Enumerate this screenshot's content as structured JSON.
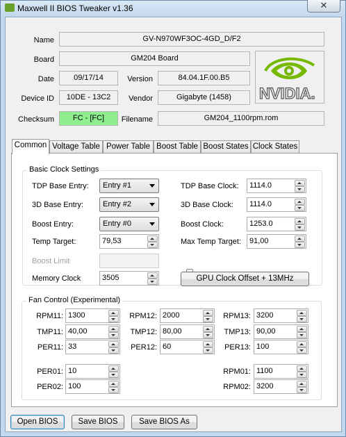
{
  "window": {
    "title": "Maxwell II BIOS Tweaker v1.36",
    "close": "✕"
  },
  "info": {
    "name_label": "Name",
    "name": "GV-N970WF3OC-4GD_D/F2",
    "board_label": "Board",
    "board": "GM204 Board",
    "date_label": "Date",
    "date": "09/17/14",
    "version_label": "Version",
    "version": "84.04.1F.00.B5",
    "device_label": "Device ID",
    "device": "10DE - 13C2",
    "vendor_label": "Vendor",
    "vendor": "Gigabyte (1458)",
    "checksum_label": "Checksum",
    "checksum": "FC - [FC]",
    "filename_label": "Filename",
    "filename": "GM204_1100rpm.rom",
    "logo_text": "NVIDIA."
  },
  "tabs": [
    "Common",
    "Voltage Table",
    "Power Table",
    "Boost Table",
    "Boost States",
    "Clock States"
  ],
  "clock": {
    "group_title": "Basic Clock Settings",
    "tdp_base_entry_label": "TDP Base Entry:",
    "tdp_base_entry": "Entry #1",
    "base3d_entry_label": "3D Base Entry:",
    "base3d_entry": "Entry #2",
    "boost_entry_label": "Boost Entry:",
    "boost_entry": "Entry #0",
    "temp_target_label": "Temp Target:",
    "temp_target": "79,53",
    "boost_limit_label": "Boost Limit",
    "memory_clock_label": "Memory Clock",
    "memory_clock": "3505",
    "tdp_base_clock_label": "TDP Base Clock:",
    "tdp_base_clock": "1114.0",
    "base3d_clock_label": "3D Base Clock:",
    "base3d_clock": "1114.0",
    "boost_clock_label": "Boost Clock:",
    "boost_clock": "1253.0",
    "max_temp_label": "Max Temp Target:",
    "max_temp": "91,00",
    "gpu_offset_button": "GPU Clock Offset + 13MHz"
  },
  "fan": {
    "group_title": "Fan Control (Experimental)",
    "rpm11_label": "RPM11:",
    "rpm11": "1300",
    "rpm12_label": "RPM12:",
    "rpm12": "2000",
    "rpm13_label": "RPM13:",
    "rpm13": "3200",
    "tmp11_label": "TMP11:",
    "tmp11": "40,00",
    "tmp12_label": "TMP12:",
    "tmp12": "80,00",
    "tmp13_label": "TMP13:",
    "tmp13": "90,00",
    "per11_label": "PER11:",
    "per11": "33",
    "per12_label": "PER12:",
    "per12": "60",
    "per13_label": "PER13:",
    "per13": "100",
    "per01_label": "PER01:",
    "per01": "10",
    "per02_label": "PER02:",
    "per02": "100",
    "rpm01_label": "RPM01:",
    "rpm01": "1100",
    "rpm02_label": "RPM02:",
    "rpm02": "3200"
  },
  "buttons": {
    "open": "Open BIOS",
    "save": "Save BIOS",
    "save_as": "Save BIOS As"
  }
}
